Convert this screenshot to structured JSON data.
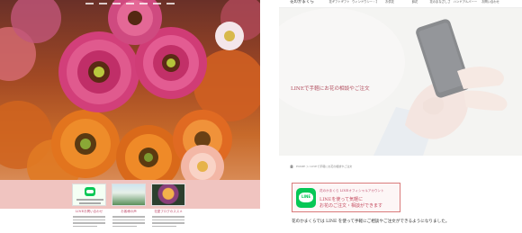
{
  "right": {
    "header": {
      "logo": "花のかまくら",
      "nav": [
        "花ギフトギフト",
        "ウィンドウシー・花束",
        "お供花",
        "鉢花",
        "花のまなざしさ",
        "ハンドアルバーー",
        "お問い合わせ"
      ]
    },
    "hero_caption": "LINEで手軽にお花の相談やご注文",
    "breadcrumb": "HOME ＞ LINEで手軽にお花の相談やご注文",
    "line_banner": {
      "logo_text": "LINE",
      "small": "花のかまくら LINEオフィシャルアカウント",
      "big_line1": "LINEを使って気軽に",
      "big_line2": "お花のご注文・相談ができます"
    },
    "bottom_text": "花のかまくらでは LINE を使って手軽にご相談やご注文ができるようになりました。"
  },
  "left": {
    "cards": [
      {
        "title": "LINEお問い合わせ"
      },
      {
        "title": "お客様の声"
      },
      {
        "title": "花屋ブログのススメ"
      }
    ]
  }
}
